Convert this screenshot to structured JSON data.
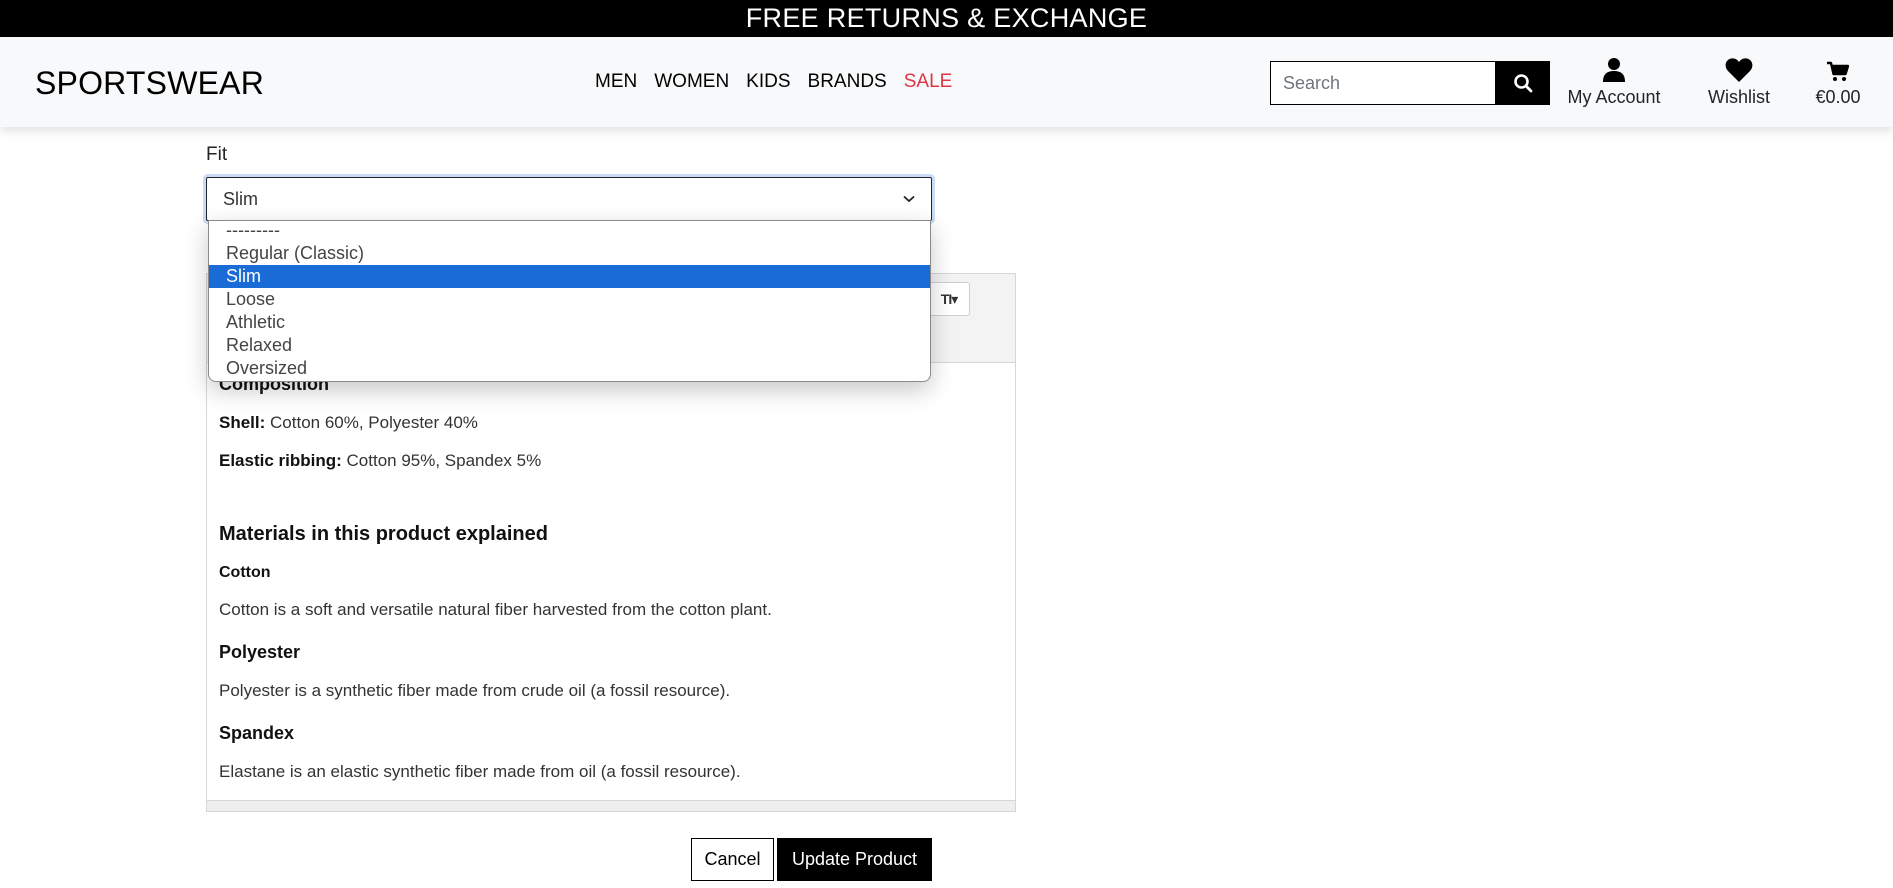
{
  "banner": {
    "text": "FREE RETURNS & EXCHANGE"
  },
  "header": {
    "logo": "SPORTSWEAR",
    "nav": [
      {
        "label": "MEN"
      },
      {
        "label": "WOMEN"
      },
      {
        "label": "KIDS"
      },
      {
        "label": "BRANDS"
      },
      {
        "label": "SALE",
        "color": "#dc3545"
      }
    ],
    "search": {
      "placeholder": "Search",
      "icon": "search-icon"
    },
    "account": {
      "label": "My Account",
      "icon": "user-icon"
    },
    "wishlist": {
      "label": "Wishlist",
      "icon": "heart-icon"
    },
    "cart": {
      "label": "€0.00",
      "icon": "cart-icon"
    }
  },
  "form": {
    "fit_label": "Fit",
    "fit_selected": "Slim",
    "fit_options": [
      "---------",
      "Regular (Classic)",
      "Slim",
      "Loose",
      "Athletic",
      "Relaxed",
      "Oversized"
    ],
    "selected_color": "#1a6bd6"
  },
  "editor": {
    "composition_heading": "Composition",
    "shell_label": "Shell:",
    "shell_value": " Cotton 60%, Polyester 40%",
    "ribbing_label": "Elastic ribbing:",
    "ribbing_value": " Cotton 95%, Spandex 5%",
    "materials_heading": "Materials in this product explained",
    "cotton_heading": "Cotton",
    "cotton_text": "Cotton is a soft and versatile natural fiber harvested from the cotton plant.",
    "polyester_heading": "Polyester",
    "polyester_text": "Polyester is a synthetic fiber made from crude oil (a fossil resource).",
    "spandex_heading": "Spandex",
    "spandex_text": "Elastane is an elastic synthetic fiber made from oil (a fossil resource)."
  },
  "actions": {
    "cancel_label": "Cancel",
    "update_label": "Update Product"
  }
}
